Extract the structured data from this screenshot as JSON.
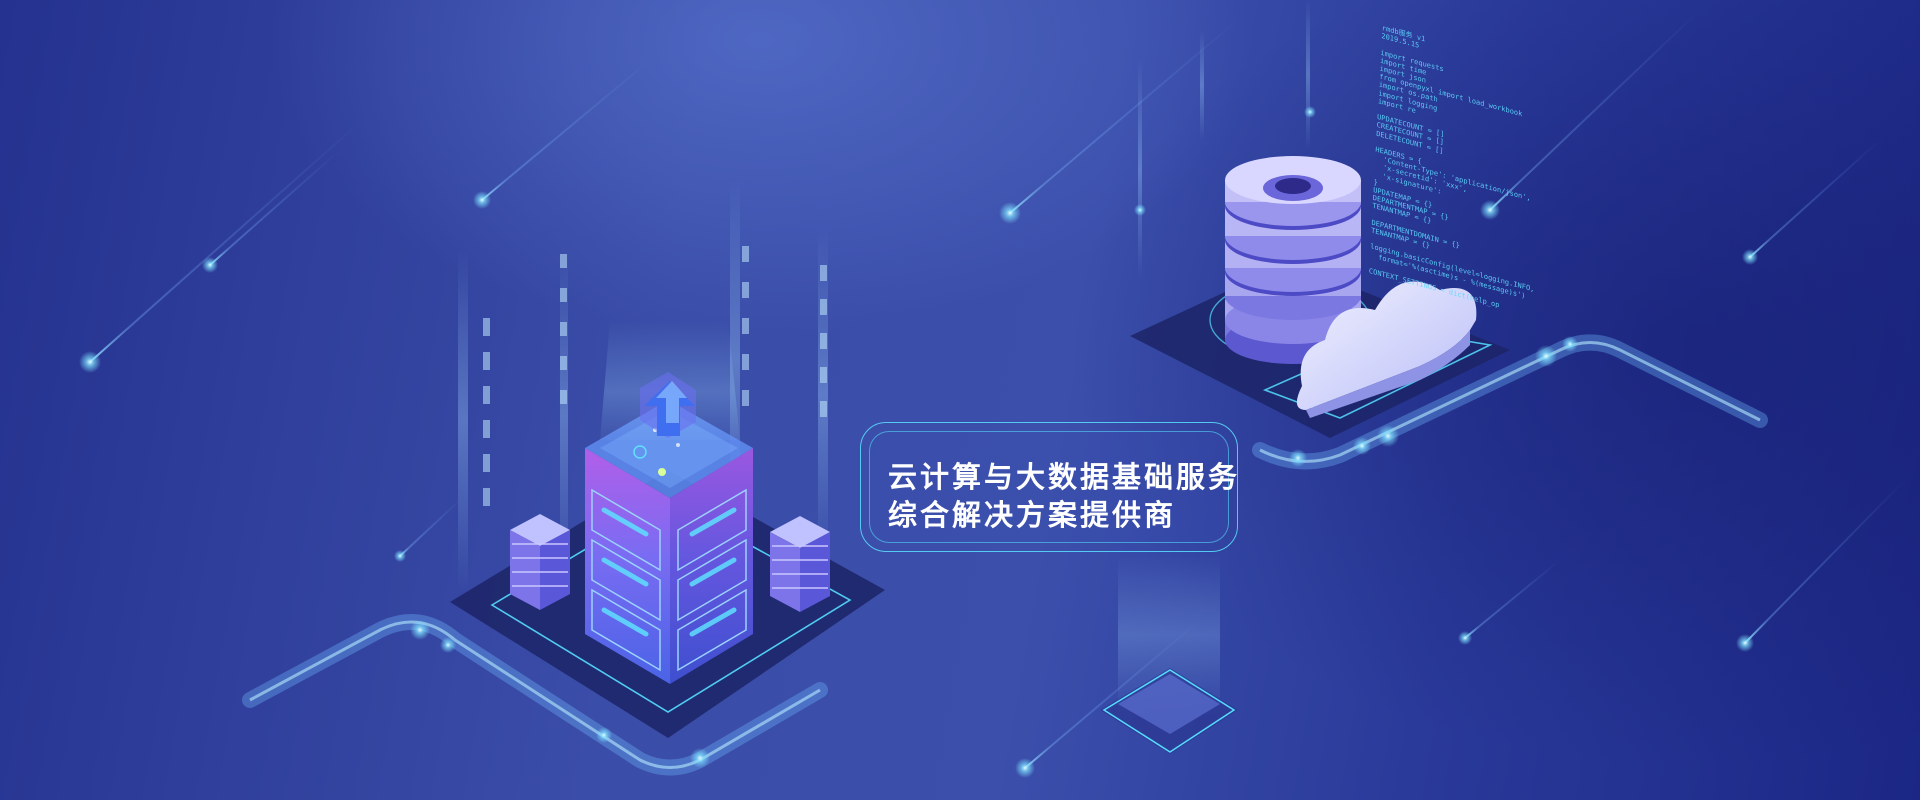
{
  "banner": {
    "tagline_line_1": "云计算与大数据基础服务",
    "tagline_line_2": "综合解决方案提供商"
  },
  "code_panel": {
    "lines": [
      "rmdb服务 v1",
      "2019.5.15",
      "",
      "import requests",
      "import time",
      "import json",
      "from openpyxl import load_workbook",
      "import os.path",
      "import logging",
      "import re",
      "",
      "UPDATECOUNT = []",
      "CREATECOUNT = []",
      "DELETECOUNT = []",
      "",
      "HEADERS = {",
      "  'Content-Type': 'application/json',",
      "  'x-secretid': 'xxx',",
      "  'x-signature':",
      "}",
      "UPDATEMAP = {}",
      "DEPARTMENTMAP = {}",
      "TENANTMAP = {}",
      "",
      "DEPARTMENTDOMAIN = {}",
      "TENANTMAP = {}",
      "",
      "logging.basicConfig(level=logging.INFO,",
      "  format='%(asctime)s - %(message)s')",
      "",
      "CONTEXT_SETTINGS = dict(help_op"
    ]
  },
  "colors": {
    "accent_cyan": "#5ae1ff",
    "tower_purple": "#a05ae6",
    "tower_blue": "#5a6ef0",
    "cloud": "#e4e6ff",
    "database": "#a9a6f0"
  },
  "icons": [
    "server-tower-icon",
    "upload-arrow-icon",
    "database-icon",
    "cloud-icon",
    "small-server-icon"
  ]
}
